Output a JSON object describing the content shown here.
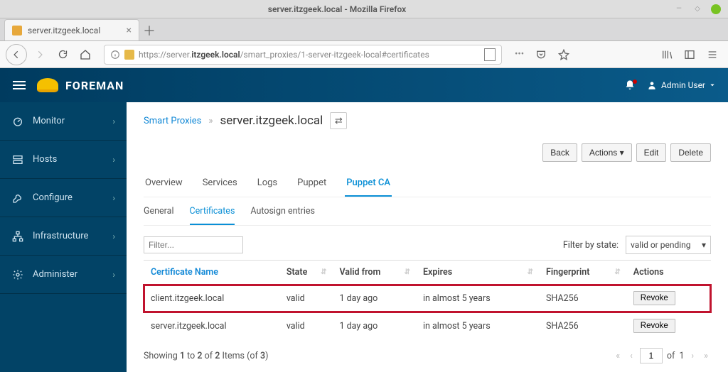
{
  "window": {
    "title": "server.itzgeek.local - Mozilla Firefox"
  },
  "browser": {
    "tab_title": "server.itzgeek.local",
    "url_prefix": "https://server.",
    "url_host": "itzgeek.local",
    "url_path": "/smart_proxies/1-server-itzgeek-local#certificates"
  },
  "app": {
    "name": "FOREMAN",
    "user": "Admin User"
  },
  "sidebar": {
    "items": [
      {
        "label": "Monitor",
        "icon": "gauge-icon"
      },
      {
        "label": "Hosts",
        "icon": "servers-icon"
      },
      {
        "label": "Configure",
        "icon": "wrench-icon"
      },
      {
        "label": "Infrastructure",
        "icon": "network-icon"
      },
      {
        "label": "Administer",
        "icon": "gear-icon"
      }
    ]
  },
  "breadcrumb": {
    "parent": "Smart Proxies",
    "current": "server.itzgeek.local"
  },
  "actions": {
    "back": "Back",
    "actions": "Actions",
    "edit": "Edit",
    "delete": "Delete"
  },
  "tabs1": [
    "Overview",
    "Services",
    "Logs",
    "Puppet",
    "Puppet CA"
  ],
  "tabs1_active": 4,
  "tabs2": [
    "General",
    "Certificates",
    "Autosign entries"
  ],
  "tabs2_active": 1,
  "filter": {
    "placeholder": "Filter...",
    "by_state_label": "Filter by state:",
    "by_state_value": "valid or pending"
  },
  "columns": [
    "Certificate Name",
    "State",
    "Valid from",
    "Expires",
    "Fingerprint",
    "Actions"
  ],
  "rows": [
    {
      "name": "client.itzgeek.local",
      "state": "valid",
      "from": "1 day ago",
      "expires": "in almost 5 years",
      "fp": "SHA256",
      "action": "Revoke",
      "hl": true
    },
    {
      "name": "server.itzgeek.local",
      "state": "valid",
      "from": "1 day ago",
      "expires": "in almost 5 years",
      "fp": "SHA256",
      "action": "Revoke",
      "hl": false
    }
  ],
  "pager": {
    "summary_prefix": "Showing ",
    "from": "1",
    "to": "2",
    "of_mid": " of ",
    "shown": "2",
    "items_mid": " Items (of ",
    "total": "3",
    "items_suffix": ")",
    "page": "1",
    "of_label": "of",
    "pages": "1"
  }
}
